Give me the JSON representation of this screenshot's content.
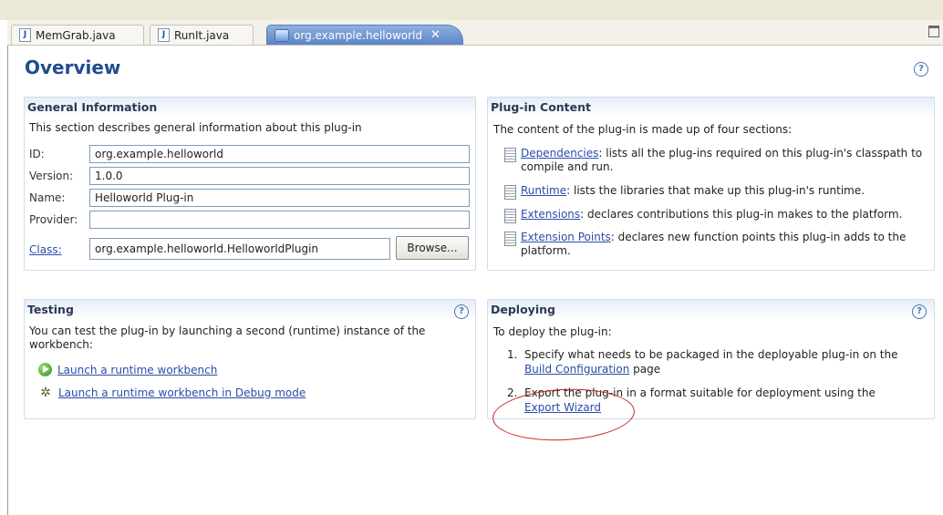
{
  "tabs": [
    {
      "label": "MemGrab.java",
      "icon": "java-file-icon"
    },
    {
      "label": "RunIt.java",
      "icon": "java-file-icon"
    },
    {
      "label": "org.example.helloworld",
      "icon": "plugin-manifest-icon",
      "active": true,
      "close": "✕"
    }
  ],
  "page": {
    "title": "Overview",
    "help": "?"
  },
  "general": {
    "title": "General Information",
    "description": "This section describes general information about this plug-in",
    "fields": {
      "id": {
        "label": "ID:",
        "value": "org.example.helloworld"
      },
      "version": {
        "label": "Version:",
        "value": "1.0.0"
      },
      "name": {
        "label": "Name:",
        "value": "Helloworld Plug-in"
      },
      "provider": {
        "label": "Provider:",
        "value": ""
      },
      "class": {
        "label": "Class:",
        "value": "org.example.helloworld.HelloworldPlugin"
      }
    },
    "browse_label": "Browse..."
  },
  "content": {
    "title": "Plug-in Content",
    "description": "The content of the plug-in is made up of four sections:",
    "items": [
      {
        "link": "Dependencies",
        "text": ": lists all the plug-ins required on this plug-in's classpath to compile and run."
      },
      {
        "link": "Runtime",
        "text": ": lists the libraries that make up this plug-in's runtime."
      },
      {
        "link": "Extensions",
        "text": ": declares contributions this plug-in makes to the platform."
      },
      {
        "link": "Extension Points",
        "text": ": declares new function points this plug-in adds to the platform."
      }
    ]
  },
  "testing": {
    "title": "Testing",
    "description": "You can test the plug-in by launching a second (runtime) instance of the workbench:",
    "launch": "Launch a runtime workbench",
    "debug": "Launch a runtime workbench in Debug mode"
  },
  "deploying": {
    "title": "Deploying",
    "description": "To deploy the plug-in:",
    "steps": [
      {
        "num": "1.",
        "text": "Specify what needs to be packaged in the deployable plug-in on the",
        "link": "Build Configuration",
        "after": " page"
      },
      {
        "num": "2.",
        "text": "Export the plug-in in a format suitable for deployment using the",
        "link": "Export Wizard",
        "after": ""
      }
    ]
  },
  "colors": {
    "title": "#214c8f",
    "link": "#2a4ca8",
    "annotation": "#cc2222"
  }
}
